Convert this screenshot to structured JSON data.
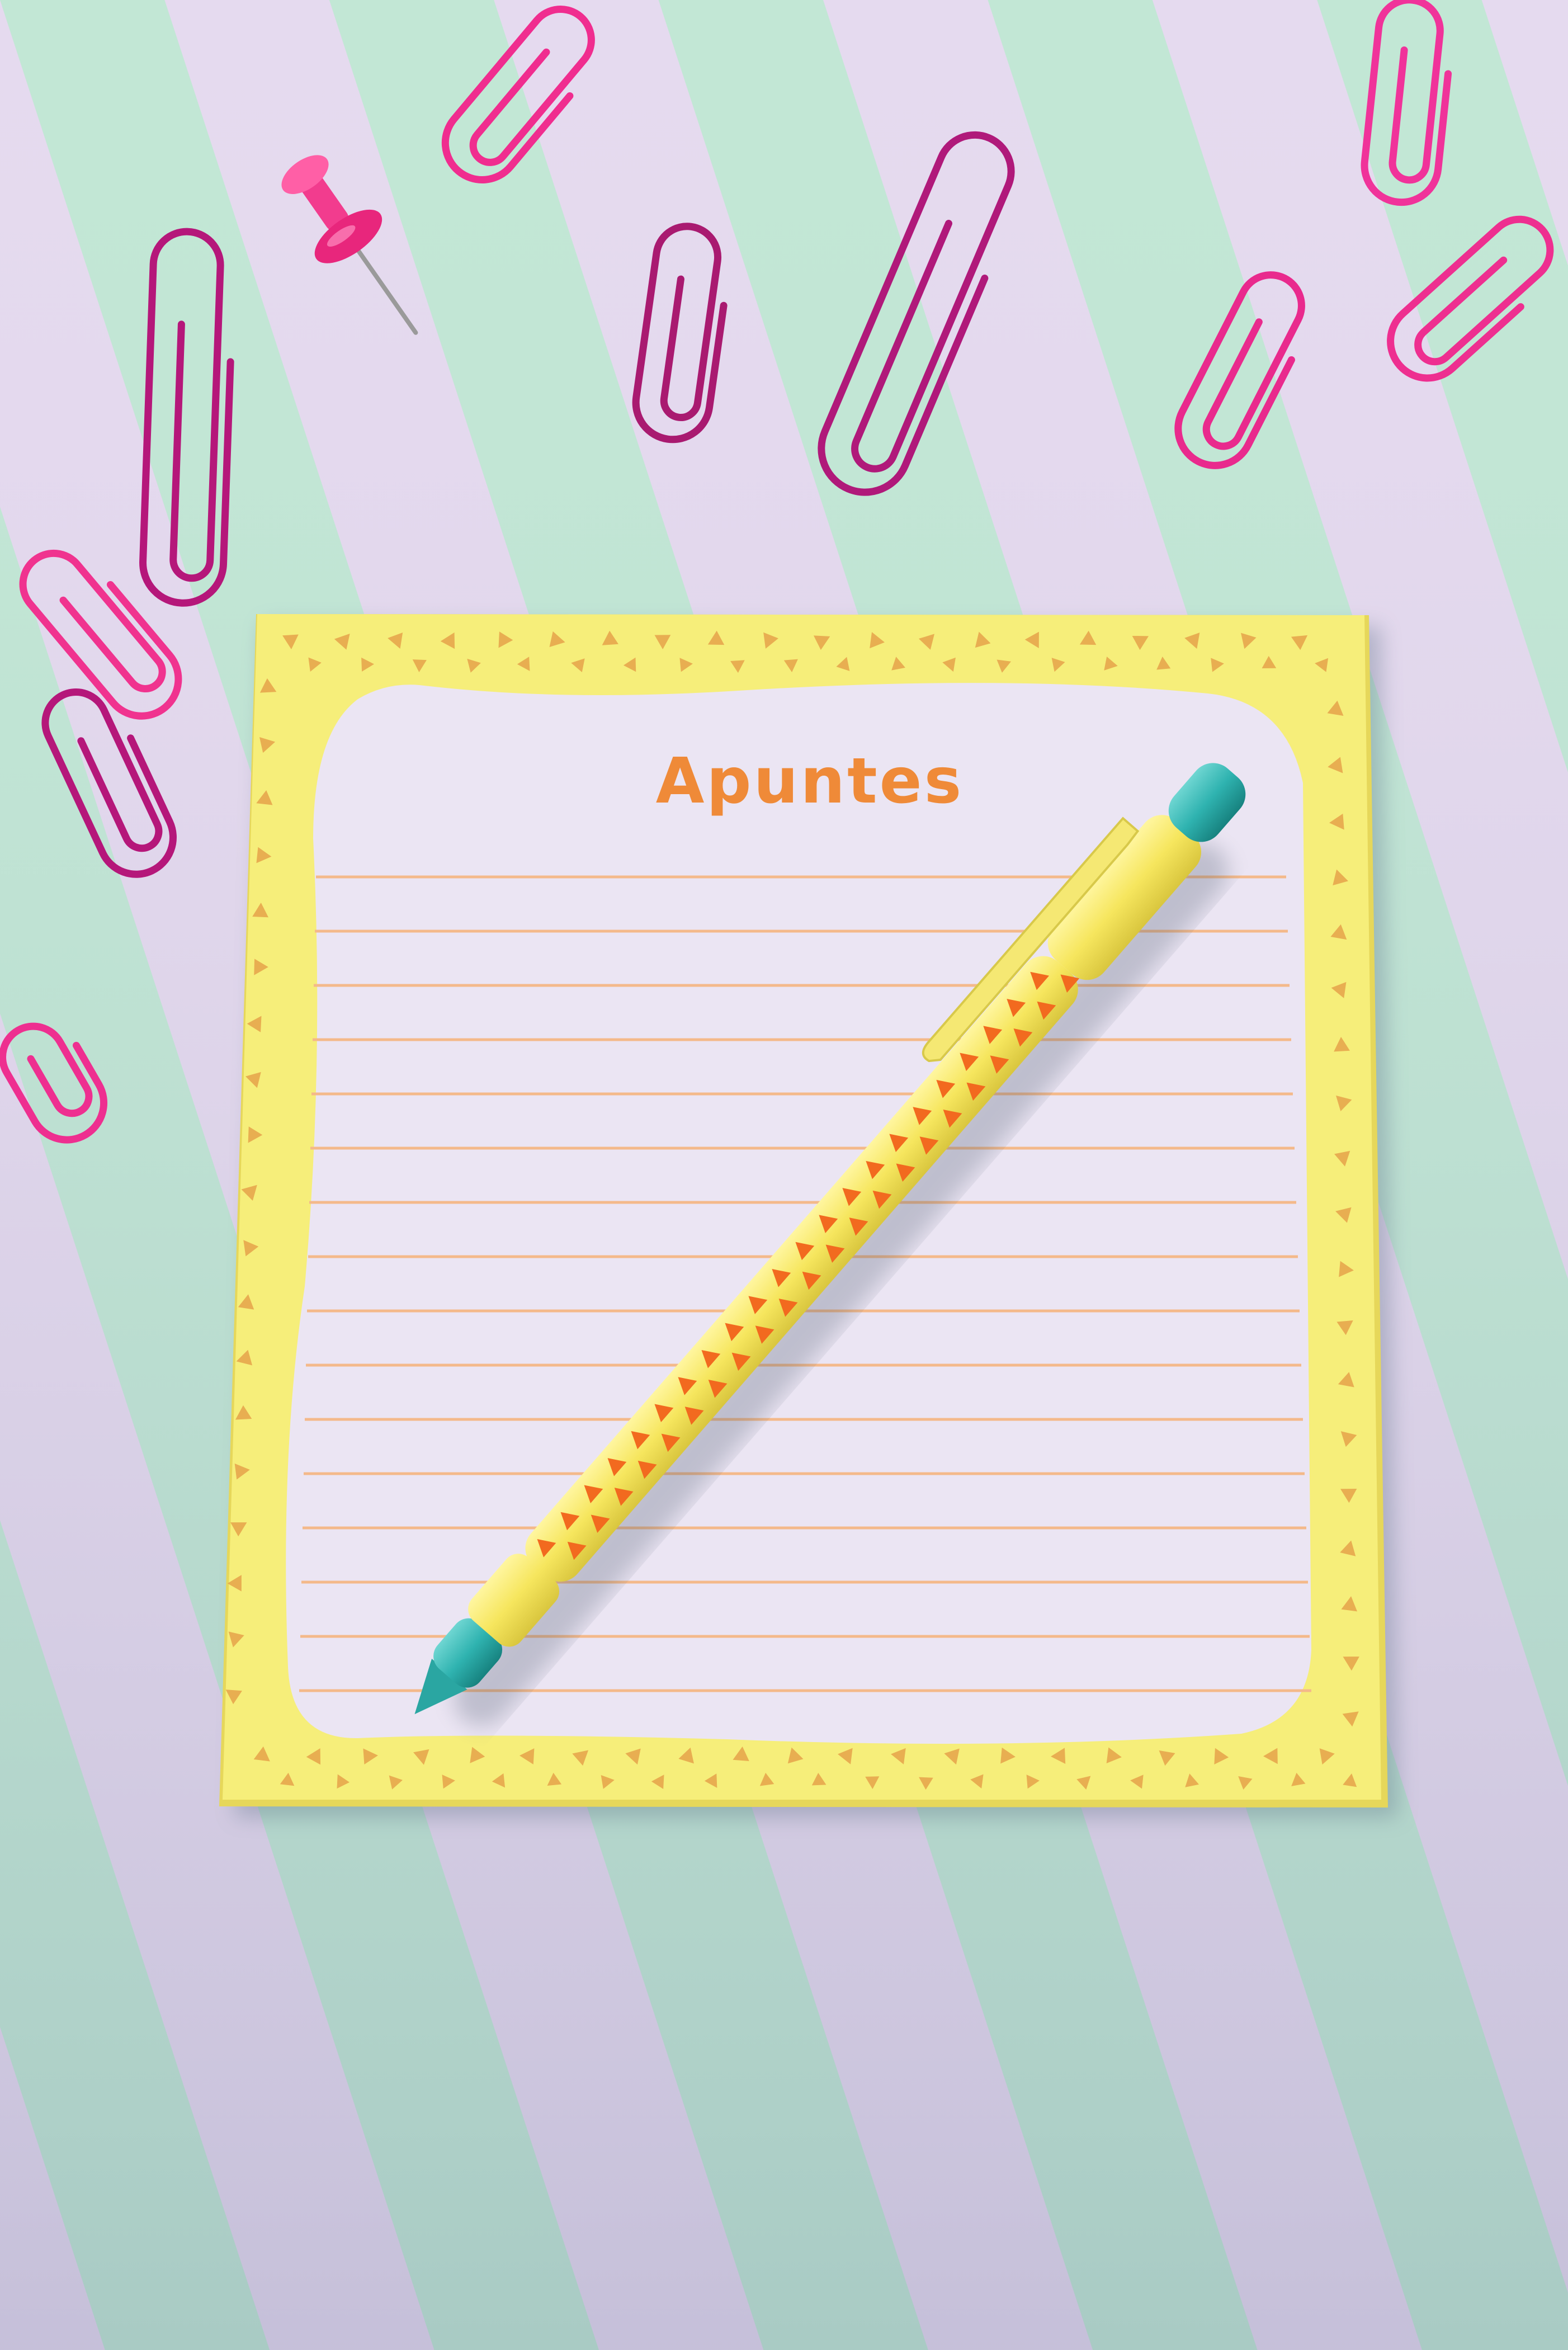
{
  "scene": {
    "description_colors": {
      "stripe_mint": "#b9e3cf",
      "stripe_lilac": "#ddd3ea",
      "notepad_yellow": "#f7ef7c",
      "notepad_paper": "#ece6f4",
      "accent_orange": "#f08a3a",
      "clip_magenta": "#c2186e",
      "clip_pink": "#f0338f",
      "pen_teal": "#2fb3b0",
      "pen_yellow": "#f7ec6e"
    }
  },
  "notepad": {
    "title": "Apuntes"
  }
}
